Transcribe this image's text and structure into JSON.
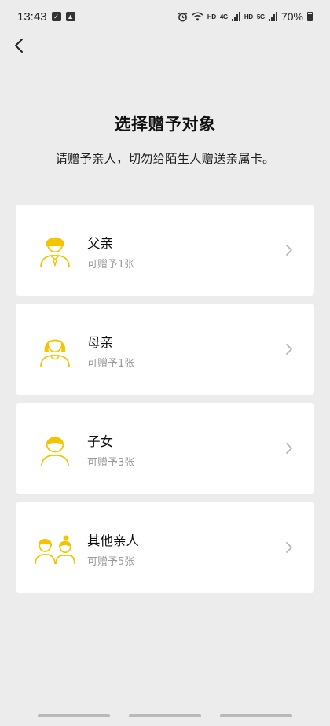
{
  "status_bar": {
    "time": "13:43",
    "network_left": "HD",
    "network_4g": "4G",
    "network_right": "HD",
    "network_5g": "5G",
    "battery": "70%"
  },
  "page": {
    "title": "选择赠予对象",
    "subtitle": "请赠予亲人，切勿给陌生人赠送亲属卡。"
  },
  "recipients": [
    {
      "name": "父亲",
      "count": "可赠予1张",
      "icon": "father-icon"
    },
    {
      "name": "母亲",
      "count": "可赠予1张",
      "icon": "mother-icon"
    },
    {
      "name": "子女",
      "count": "可赠予3张",
      "icon": "child-icon"
    },
    {
      "name": "其他亲人",
      "count": "可赠予5张",
      "icon": "family-icon"
    }
  ],
  "colors": {
    "accent": "#f5c400",
    "background": "#ececec",
    "card": "#ffffff"
  }
}
